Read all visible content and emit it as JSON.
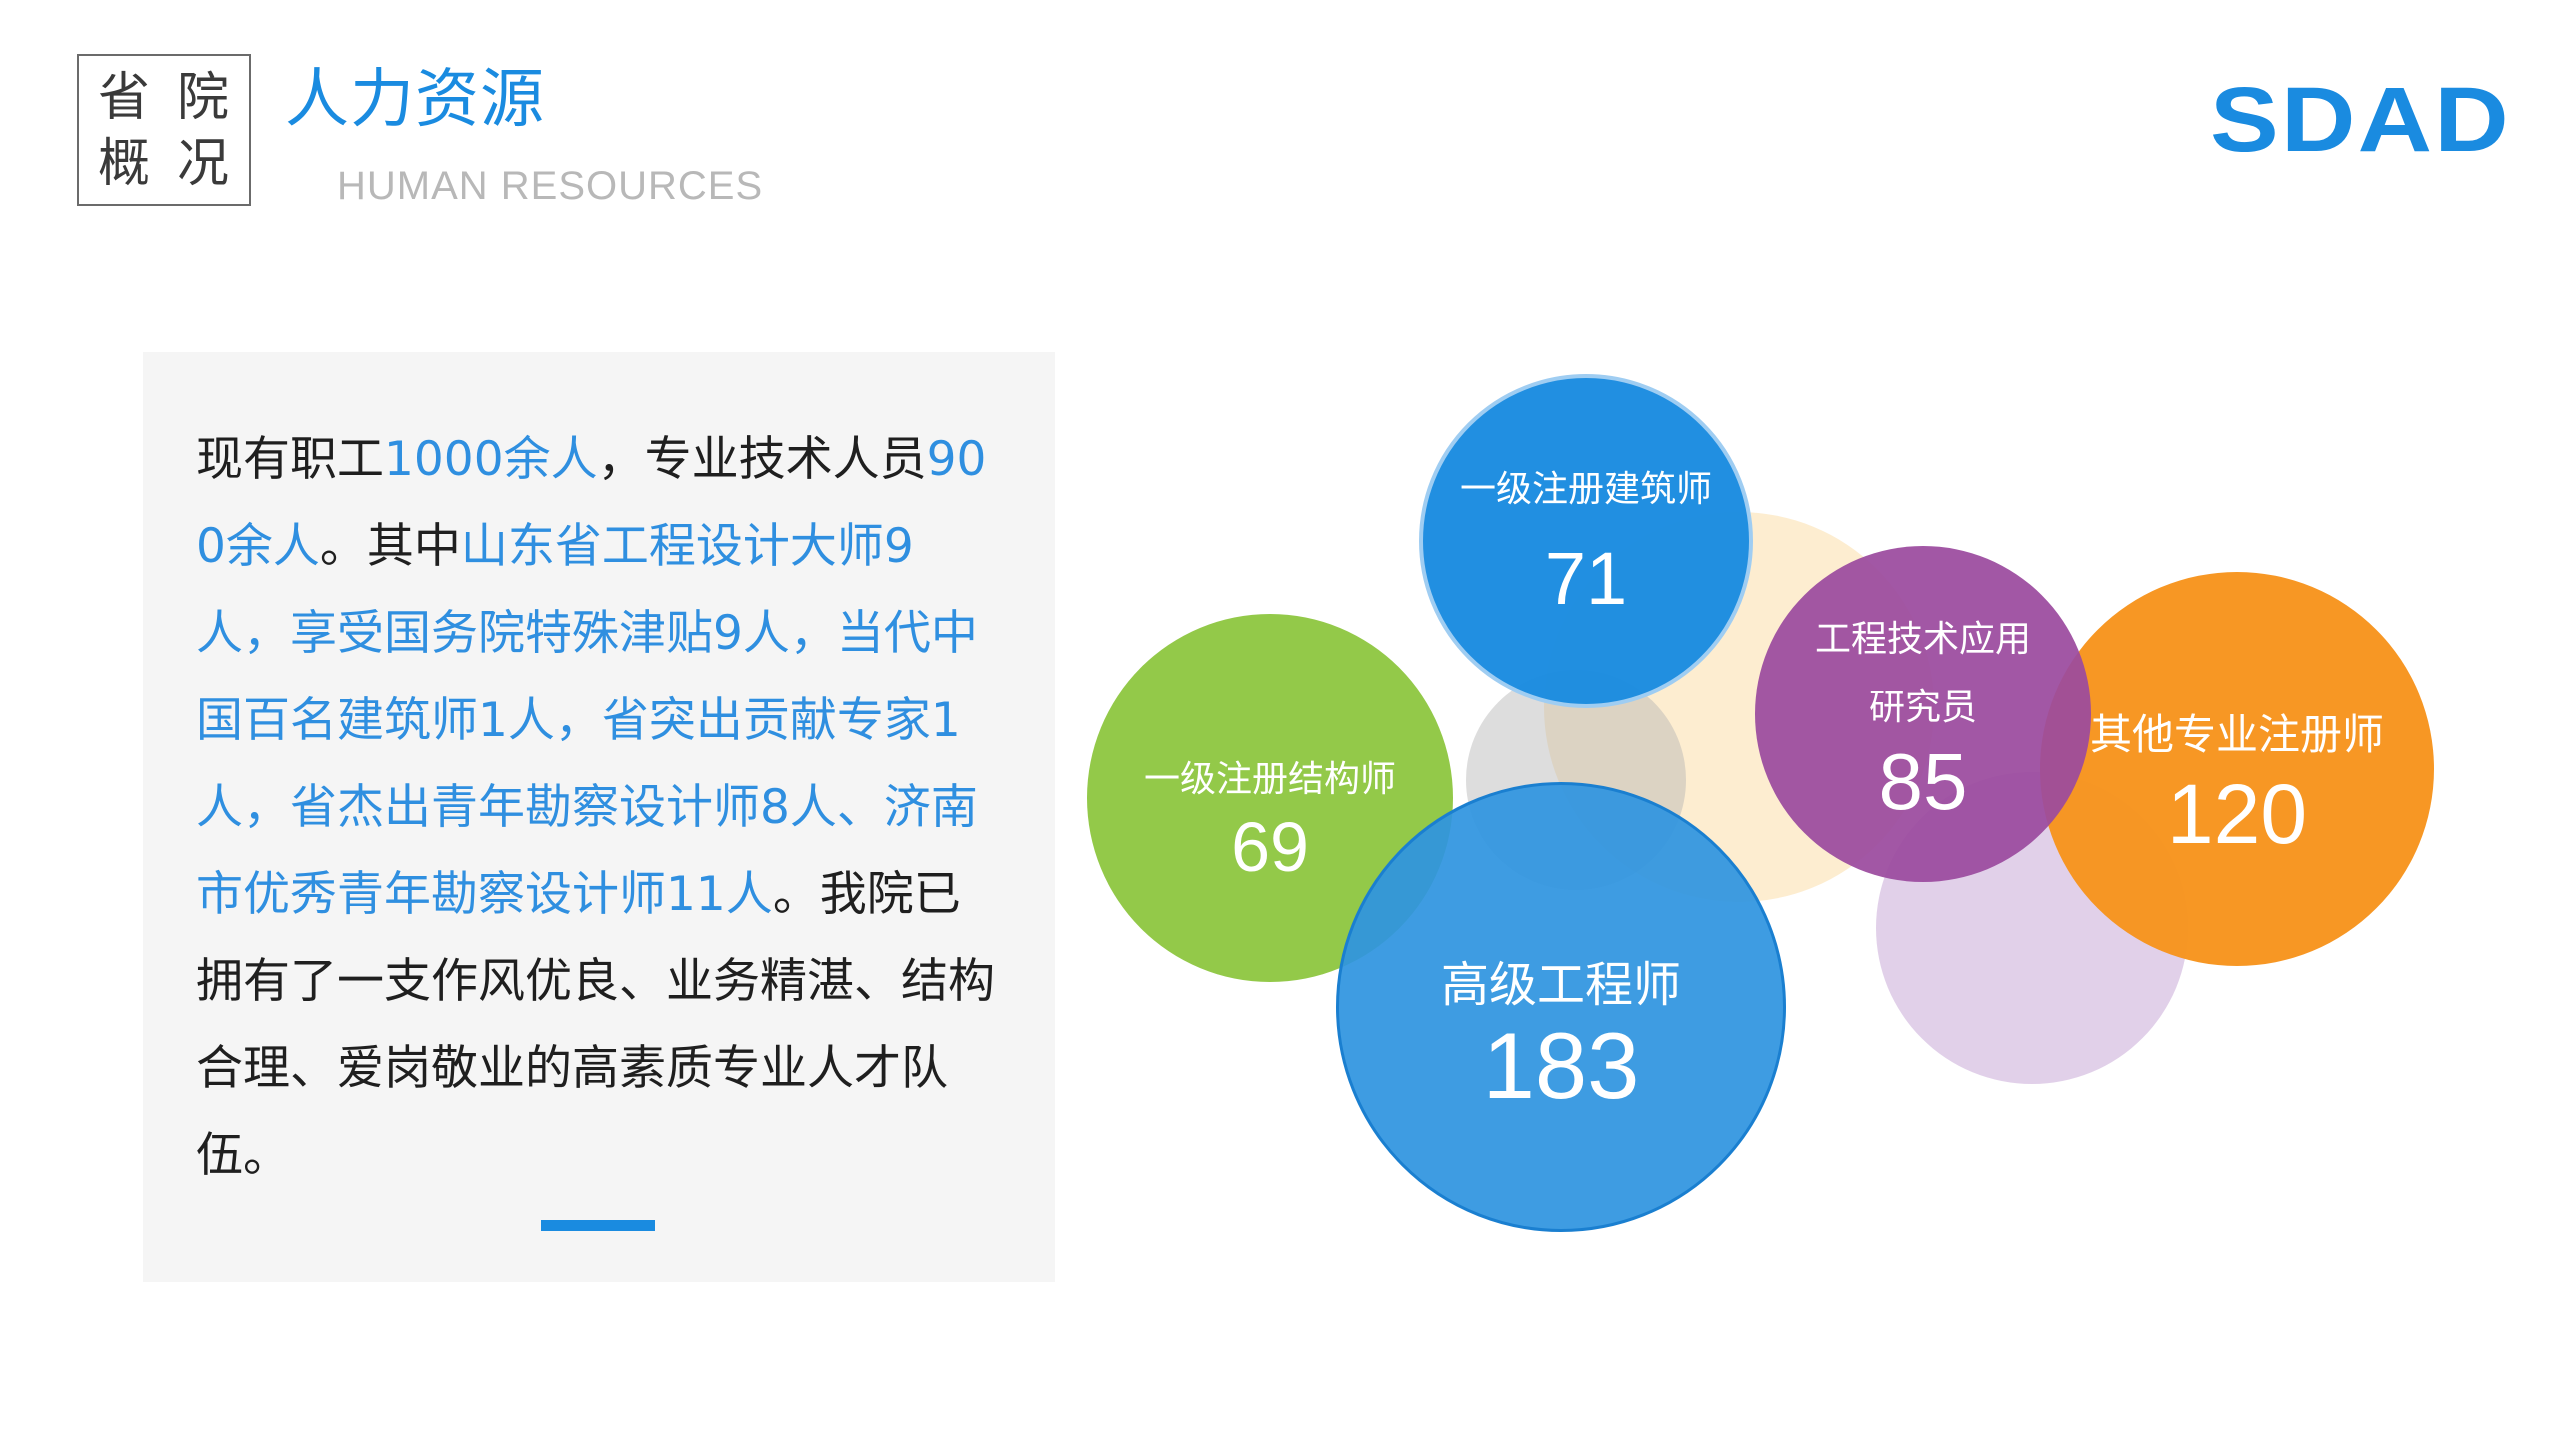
{
  "header": {
    "section_chars": [
      "省",
      "院",
      "概",
      "况"
    ],
    "title_cn": "人力资源",
    "title_en": "HUMAN RESOURCES",
    "logo": "SDAD"
  },
  "intro": {
    "segments": [
      {
        "text": "现有职工",
        "highlight": false
      },
      {
        "text": "1000余人",
        "highlight": true
      },
      {
        "text": "，专业技术人员",
        "highlight": false
      },
      {
        "text": "900余人",
        "highlight": true
      },
      {
        "text": "。其中",
        "highlight": false
      },
      {
        "text": "山东省工程设计大师9人，享受国务院特殊津贴9人，当代中国百名建筑师1人，省突出贡献专家1人，省杰出青年勘察设计师8人、济南市优秀青年勘察设计师11人",
        "highlight": true
      },
      {
        "text": "。我院已拥有了一支作风优良、业务精湛、结构合理、爱岗敬业的高素质专业人才队伍。",
        "highlight": false
      }
    ]
  },
  "bubbles": [
    {
      "label": "一级注册建筑师",
      "value": "71",
      "color": "#1a8be0"
    },
    {
      "label": "一级注册结构师",
      "value": "69",
      "color": "#8dc63f"
    },
    {
      "label": "高级工程师",
      "value": "183",
      "color": "#2f95e0"
    },
    {
      "label": "工程技术应用",
      "label2": "研究员",
      "value": "85",
      "color": "#9b4a9e"
    },
    {
      "label": "其他专业注册师",
      "value": "120",
      "color": "#f7941d"
    }
  ],
  "colors": {
    "accent": "#1a8be0",
    "highlight_text": "#2f8fe0",
    "panel_bg": "#f5f5f5"
  }
}
